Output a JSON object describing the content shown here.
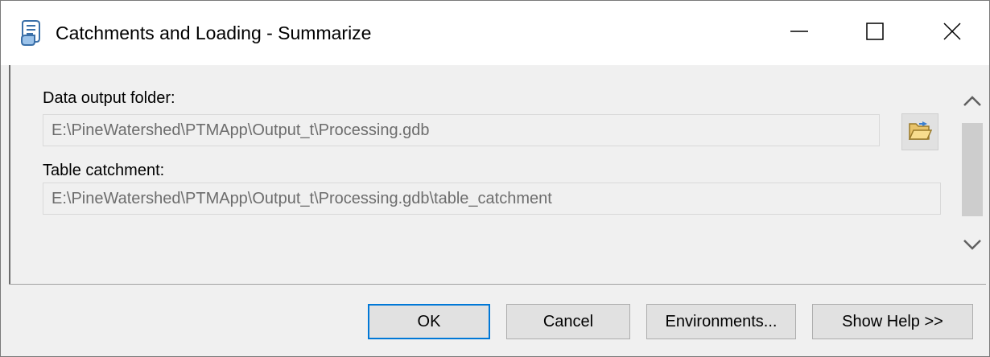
{
  "window": {
    "title": "Catchments and Loading - Summarize",
    "controls": {
      "minimize_icon": "minimize-icon",
      "maximize_icon": "maximize-icon",
      "close_icon": "close-icon"
    }
  },
  "form": {
    "output_folder": {
      "label": "Data output folder:",
      "value": "E:\\PineWatershed\\PTMApp\\Output_t\\Processing.gdb",
      "browse_icon": "open-folder-icon"
    },
    "table_catchment": {
      "label": "Table catchment:",
      "value": "E:\\PineWatershed\\PTMApp\\Output_t\\Processing.gdb\\table_catchment"
    }
  },
  "scrollbar": {
    "up_icon": "chevron-up-icon",
    "down_icon": "chevron-down-icon"
  },
  "buttons": {
    "ok": "OK",
    "cancel": "Cancel",
    "environments": "Environments...",
    "show_help": "Show Help >>"
  },
  "colors": {
    "accent": "#0078d7",
    "window_bg": "#f0f0f0",
    "disabled_text": "#6d6d6d"
  }
}
